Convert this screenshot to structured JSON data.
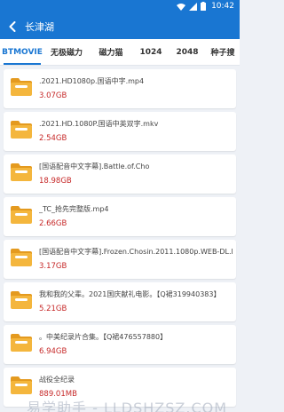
{
  "status_bar": {
    "time": "10:42"
  },
  "app_bar": {
    "title": "长津湖",
    "back_icon": "arrow-back-icon"
  },
  "tabs": [
    {
      "label": "BTMOVIE",
      "active": true
    },
    {
      "label": "无极磁力",
      "active": false
    },
    {
      "label": "磁力猫",
      "active": false
    },
    {
      "label": "1024",
      "active": false
    },
    {
      "label": "2048",
      "active": false
    },
    {
      "label": "种子搜",
      "active": false
    }
  ],
  "results": [
    {
      "name": ".2021.HD1080p.国语中字.mp4",
      "size": "3.07GB"
    },
    {
      "name": ".2021.HD.1080P.国语中英双字.mkv",
      "size": "2.54GB"
    },
    {
      "name": "[国语配音中文字幕].Battle.of.Cho",
      "size": "18.98GB"
    },
    {
      "name": "_TC_抢先完整版.mp4",
      "size": "2.66GB"
    },
    {
      "name": "[国语配音中文字幕].Frozen.Chosin.2011.1080p.WEB-DL.H",
      "size": "3.17GB"
    },
    {
      "name": "我和我的父辈。2021国庆献礼电影。【Q裙319940383】",
      "size": "5.21GB"
    },
    {
      "name": "。中美纪录片合集。【Q裙476557880】",
      "size": "6.94GB"
    },
    {
      "name": "战役全纪录",
      "size": "889.01MB"
    }
  ],
  "watermark": "易学助手 - LLDSHZSZ.COM",
  "colors": {
    "primary": "#1976d2",
    "size_text": "#c62828",
    "folder_body": "#f4b63d",
    "folder_tab": "#e49a1f"
  }
}
